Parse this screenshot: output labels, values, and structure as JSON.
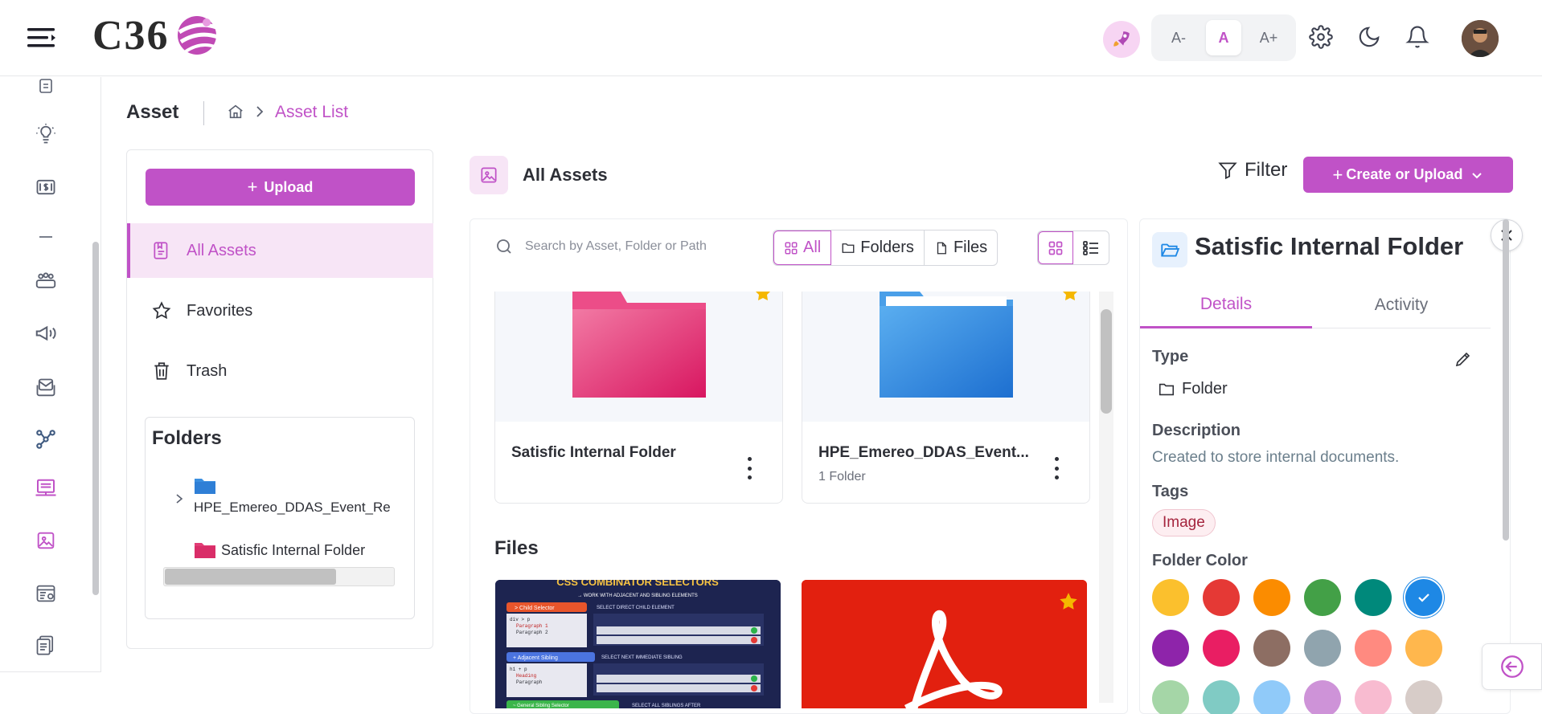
{
  "header": {
    "logo_text": "C36",
    "font_small": "A-",
    "font_normal": "A",
    "font_large": "A+"
  },
  "page": {
    "title": "Asset",
    "breadcrumb_current": "Asset List"
  },
  "left_panel": {
    "upload_label": "Upload",
    "nav": [
      {
        "label": "All Assets",
        "icon": "all-assets-icon",
        "active": true
      },
      {
        "label": "Favorites",
        "icon": "star-icon",
        "active": false
      },
      {
        "label": "Trash",
        "icon": "trash-icon",
        "active": false
      }
    ],
    "folders_title": "Folders",
    "folders": [
      {
        "label": "HPE_Emereo_DDAS_Event_Re",
        "color": "#3b8fe0"
      },
      {
        "label": "Satisfic Internal Folder",
        "color": "#e23d76"
      }
    ]
  },
  "main": {
    "title": "All Assets",
    "filter_label": "Filter",
    "create_label": "Create or Upload",
    "search_placeholder": "Search by Asset, Folder or Path",
    "segments": [
      "All",
      "Folders",
      "Files"
    ],
    "folder_cards": [
      {
        "name": "Satisfic Internal Folder",
        "sub": "",
        "color": "#e23d76",
        "favorite": true
      },
      {
        "name": "HPE_Emereo_DDAS_Event...",
        "sub": "1 Folder",
        "color": "#3b8fe0",
        "favorite": true
      }
    ],
    "files_title": "Files",
    "file_cards": [
      {
        "type": "image",
        "title": "CSS COMBINATOR SELECTORS",
        "subtitle": "→ WORK WITH ADJACENT AND SIBLING ELEMENTS",
        "rows": [
          {
            "tag": "> Child Selector",
            "caption": "SELECT DIRECT CHILD ELEMENT",
            "lines": [
              "div > p",
              "Paragraph 1",
              "Paragraph 2"
            ]
          },
          {
            "tag": "+ Adjacent Sibling",
            "caption": "SELECT NEXT IMMEDIATE SIBLING",
            "lines": [
              "h1 + p",
              "Heading",
              "Paragraph"
            ]
          },
          {
            "tag": "~ General Sibling Selector",
            "caption": "SELECT ALL SIBLINGS AFTER",
            "lines": []
          }
        ]
      },
      {
        "type": "pdf",
        "favorite": true
      }
    ]
  },
  "details": {
    "title": "Satisfic Internal Folder",
    "tabs": [
      "Details",
      "Activity"
    ],
    "type_label": "Type",
    "type_value": "Folder",
    "description_label": "Description",
    "description_value": "Created to store internal documents.",
    "tags_label": "Tags",
    "tags": [
      "Image"
    ],
    "color_label": "Folder Color",
    "colors": [
      "#fbc02d",
      "#e53935",
      "#fb8c00",
      "#43a047",
      "#00897b",
      "#1e88e5",
      "#8e24aa",
      "#e91e63",
      "#8d6e63",
      "#90a4ae",
      "#ff8a80",
      "#ffb74d",
      "#a5d6a7",
      "#80cbc4",
      "#90caf9",
      "#ce93d8",
      "#f8bbd0",
      "#d7ccc8"
    ],
    "selected_color": "#1e88e5"
  },
  "colors": {
    "accent": "#c052c7",
    "accent_light": "#f7e5f6"
  }
}
